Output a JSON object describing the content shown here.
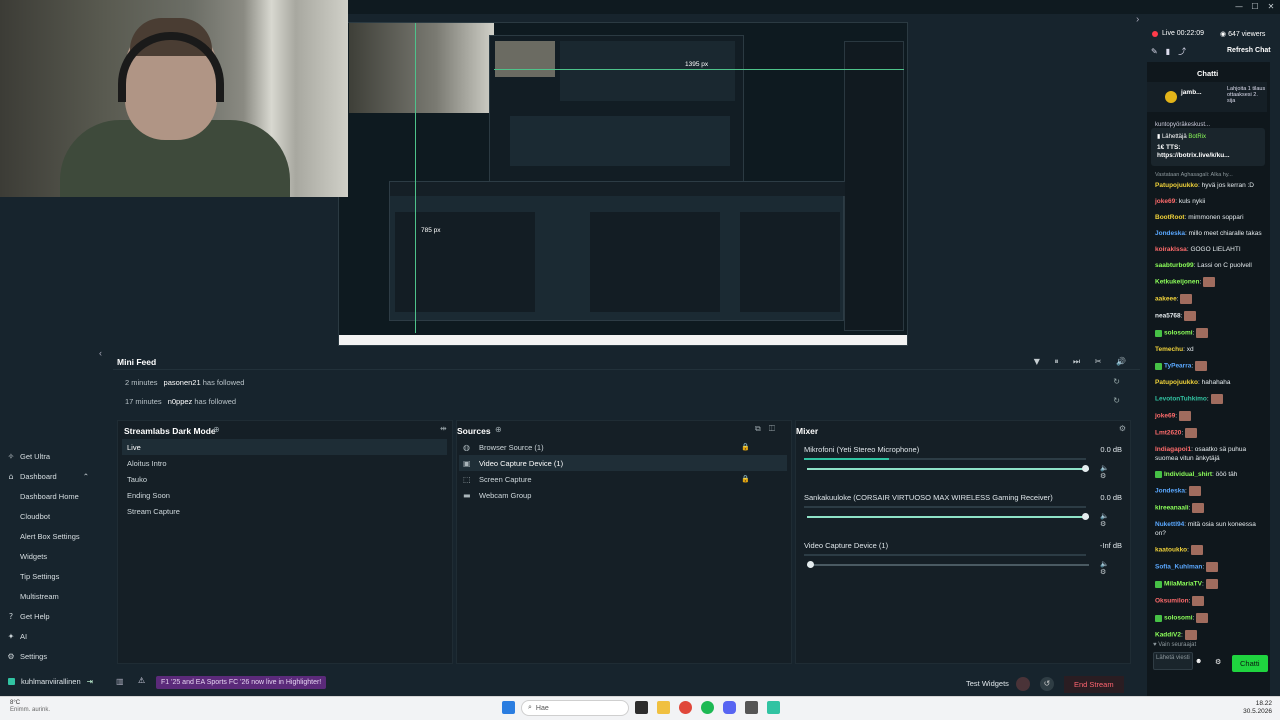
{
  "window": {
    "minimize": "—",
    "maximize": "☐",
    "close": "✕"
  },
  "preview": {
    "label_width": "1395 px",
    "label_height": "785 px"
  },
  "minifeed": {
    "title": "Mini Feed",
    "events": [
      {
        "time": "2 minutes",
        "user": "pasonen21",
        "action": "has followed"
      },
      {
        "time": "17 minutes",
        "user": "n0ppez",
        "action": "has followed"
      }
    ]
  },
  "scenes": {
    "title": "Streamlabs Dark Mode",
    "items": [
      "Live",
      "Aloitus Intro",
      "Tauko",
      "Ending Soon",
      "Stream Capture"
    ],
    "active": "Live"
  },
  "sources": {
    "title": "Sources",
    "items": [
      "Browser Source (1)",
      "Video Capture Device (1)",
      "Screen Capture",
      "Webcam Group"
    ]
  },
  "mixer": {
    "title": "Mixer",
    "channels": [
      {
        "name": "Mikrofoni (Yeti Stereo Microphone)",
        "db": "0.0 dB",
        "level": 0.3,
        "volume": 1.0
      },
      {
        "name": "Sankakuuloke (CORSAIR VIRTUOSO MAX WIRELESS Gaming Receiver)",
        "db": "0.0 dB",
        "level": 0.0,
        "volume": 1.0
      },
      {
        "name": "Video Capture Device (1)",
        "db": "-Inf dB",
        "level": 0.0,
        "volume": 0.0
      }
    ]
  },
  "sidebar": {
    "items": [
      {
        "label": "Get Ultra",
        "icon": "ultra-icon",
        "sub": false
      },
      {
        "label": "Dashboard",
        "icon": "dashboard-icon",
        "sub": false
      },
      {
        "label": "Dashboard Home",
        "sub": true
      },
      {
        "label": "Cloudbot",
        "sub": true
      },
      {
        "label": "Alert Box Settings",
        "sub": true
      },
      {
        "label": "Widgets",
        "sub": true
      },
      {
        "label": "Tip Settings",
        "sub": true
      },
      {
        "label": "Multistream",
        "sub": true
      },
      {
        "label": "Get Help",
        "icon": "help-icon",
        "sub": false
      },
      {
        "label": "AI",
        "icon": "ai-icon",
        "sub": false
      },
      {
        "label": "Settings",
        "icon": "settings-icon",
        "sub": false
      }
    ],
    "user": "kuhlmanviirallinen"
  },
  "bottombar": {
    "promo": "F1 '25 and EA Sports FC '26 now live in Highlighter!",
    "test_widgets": "Test Widgets",
    "end_stream": "End Stream"
  },
  "chat": {
    "status": "Live 00:22:09",
    "viewers": "647 viewers",
    "refresh": "Refresh Chat",
    "title": "Chatti",
    "pinned_user": "jamb...",
    "pinned_gift": "Lahjoita 1 tilaus ottaaksesi 2. sija",
    "overlap_text": "kuntopyöräkeskust...",
    "tts_sender": "Lähettäjä",
    "tts_bot": "BotRix",
    "tts_text": "1€ TTS: https://botrix.live/k/ku...",
    "reply_to": "Vastataan Aghasagali: Alka hy...",
    "messages": [
      {
        "user": "Patupojuukko",
        "color": "#f0d23a",
        "text": "hyvä jos kerran :D"
      },
      {
        "user": "joke69",
        "color": "#ff6b6b",
        "text": "kuls nykii"
      },
      {
        "user": "BootRoot",
        "color": "#f0d23a",
        "text": "mimmonen soppari"
      },
      {
        "user": "Jondeska",
        "color": "#5aa8ff",
        "text": "millo meet chiaralle takas"
      },
      {
        "user": "koiraklssa",
        "color": "#ff6b6b",
        "text": "GOGO LIELAHTI"
      },
      {
        "user": "saabturbo99",
        "color": "#8cff5a",
        "text": "Lassi on C puolvell"
      },
      {
        "user": "Ketkukeijonen",
        "color": "#8cff5a",
        "text": "",
        "emote": true
      },
      {
        "user": "aakeee",
        "color": "#f0d23a",
        "text": "",
        "emote": true
      },
      {
        "user": "nea5768",
        "color": "#e6ecef",
        "text": "",
        "emote": true
      },
      {
        "user": "solosomi",
        "color": "#8cff5a",
        "text": "",
        "emote": true,
        "badge": true
      },
      {
        "user": "Temechu",
        "color": "#f0d23a",
        "text": "xd"
      },
      {
        "user": "TyPearra",
        "color": "#5aa8ff",
        "text": "",
        "emote": true,
        "badge": true
      },
      {
        "user": "Patupojuukko",
        "color": "#f0d23a",
        "text": "hahahaha"
      },
      {
        "user": "LevotonTuhkimo",
        "color": "#31c3a2",
        "text": "",
        "emote": true
      },
      {
        "user": "joke69",
        "color": "#ff6b6b",
        "text": "",
        "emote": true
      },
      {
        "user": "Lmt2620",
        "color": "#ff6b6b",
        "text": "",
        "emote": true
      },
      {
        "user": "Indiagapoi1",
        "color": "#ff6b6b",
        "text": "osaatko sä puhua suomea vitun änkytäjä"
      },
      {
        "user": "Individual_shirt",
        "color": "#8cff5a",
        "text": "ööö täh",
        "badge": true
      },
      {
        "user": "Jondeska",
        "color": "#5aa8ff",
        "text": "",
        "emote": true
      },
      {
        "user": "kireeanaali",
        "color": "#8cff5a",
        "text": "",
        "emote": true
      },
      {
        "user": "Nukettl94",
        "color": "#5aa8ff",
        "text": "mitä osia sun koneessa on?"
      },
      {
        "user": "kaatoukko",
        "color": "#f0d23a",
        "text": "",
        "emote": true
      },
      {
        "user": "Sofia_Kuhlman",
        "color": "#5aa8ff",
        "text": "",
        "emote": true
      },
      {
        "user": "MilaMariaTV",
        "color": "#8cff5a",
        "text": "",
        "emote": true,
        "badge": true
      },
      {
        "user": "Oksumilon",
        "color": "#ff6b6b",
        "text": "",
        "emote": true
      },
      {
        "user": "solosomi",
        "color": "#8cff5a",
        "text": "",
        "emote": true,
        "badge": true
      },
      {
        "user": "KaddiV2",
        "color": "#8cff5a",
        "text": "",
        "emote": true
      }
    ],
    "followers_only": "Vain seuraajat",
    "input_placeholder": "Lähetä viesti",
    "send": "Chatti"
  },
  "taskbar": {
    "search": "Hae",
    "time": "18.22",
    "date": "30.5.2026",
    "weather_temp": "8°C",
    "weather_desc": "Enimm. aurink."
  },
  "colors": {
    "accent": "#31c3a2",
    "live": "#ff3b4a",
    "chat_send": "#1fd43f",
    "end_stream": "#ff6470"
  }
}
